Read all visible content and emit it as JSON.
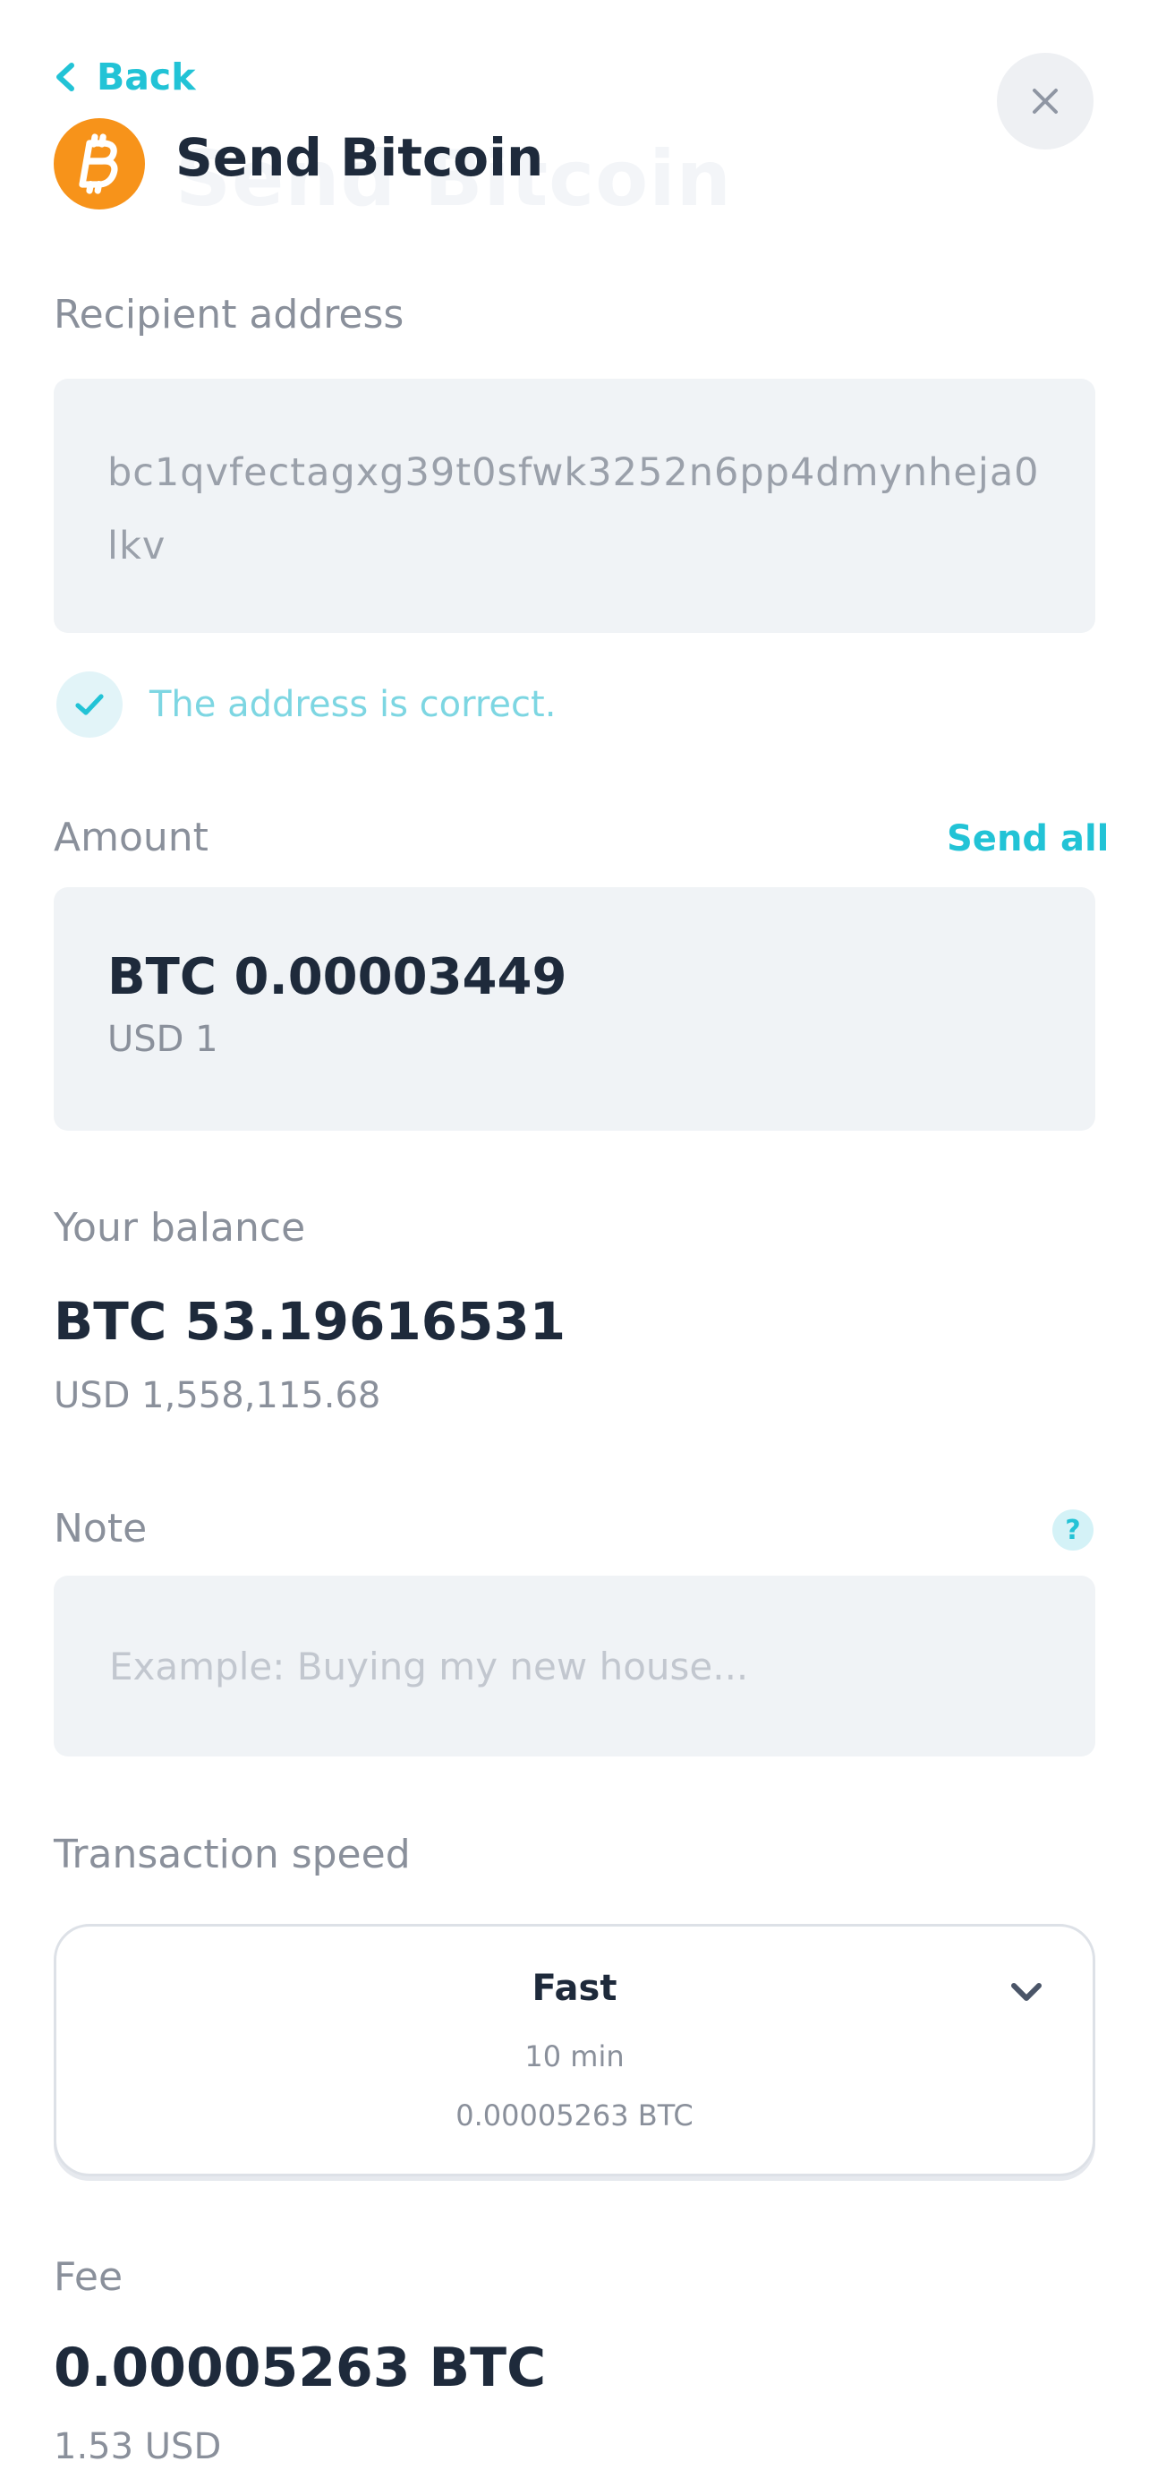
{
  "header": {
    "back_label": "Back",
    "title": "Send Bitcoin",
    "coin_icon": "bitcoin-icon",
    "close_icon": "close-icon"
  },
  "recipient": {
    "label": "Recipient address",
    "address": "bc1qvfectagxg39t0sfwk3252n6pp4dmynheja0lkv",
    "validation_message": "The address is correct."
  },
  "amount": {
    "label": "Amount",
    "send_all_label": "Send all",
    "btc": "BTC 0.00003449",
    "usd": "USD 1"
  },
  "balance": {
    "label": "Your balance",
    "btc": "BTC 53.19616531",
    "usd": "USD 1,558,115.68"
  },
  "note": {
    "label": "Note",
    "help_glyph": "?",
    "placeholder": "Example: Buying my new house...",
    "value": ""
  },
  "transaction_speed": {
    "label": "Transaction speed",
    "selected": {
      "name": "Fast",
      "time": "10 min",
      "fee": "0.00005263 BTC"
    }
  },
  "fee": {
    "label": "Fee",
    "btc": "0.00005263 BTC",
    "usd": "1.53 USD"
  },
  "colors": {
    "accent": "#22c3d6",
    "bitcoin": "#f7931a",
    "text_dark": "#1e2a3b",
    "text_muted": "#8a909b",
    "field_bg": "#f0f3f6"
  }
}
